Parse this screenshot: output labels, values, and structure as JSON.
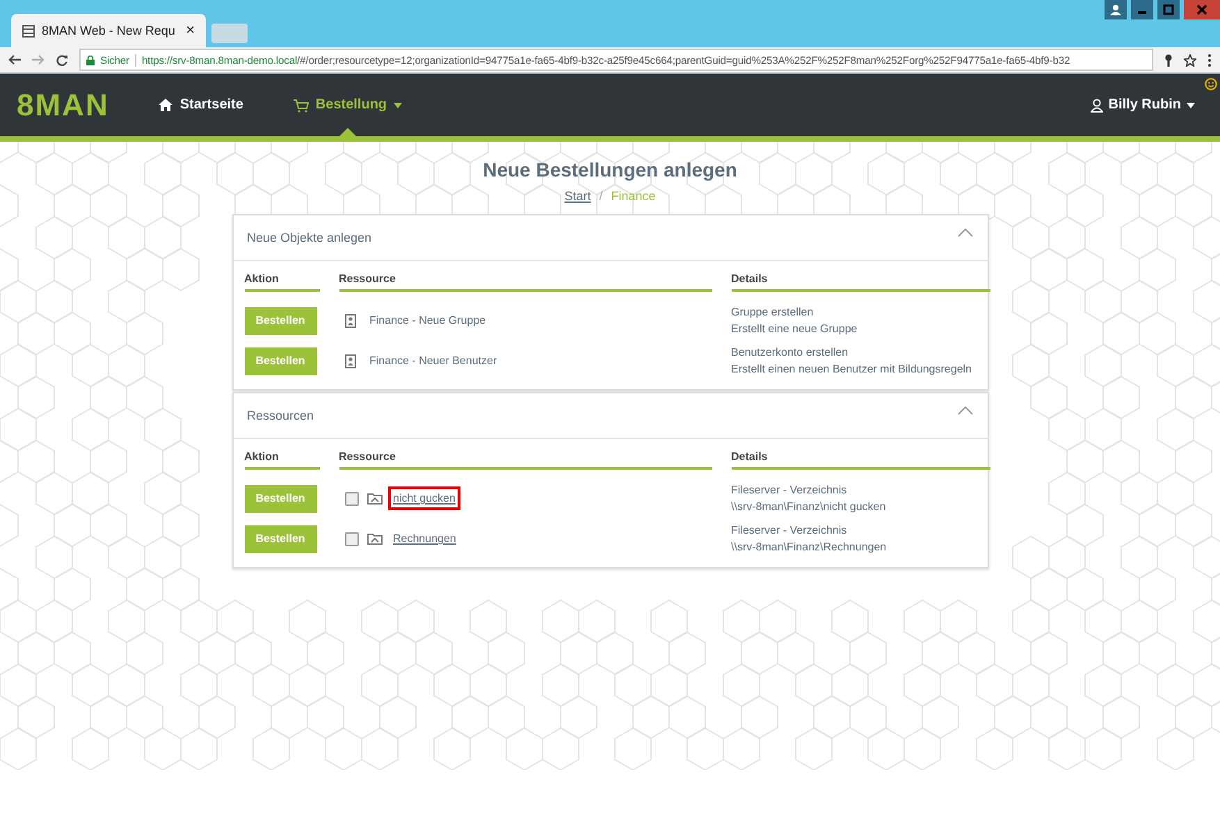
{
  "browser": {
    "tab_title": "8MAN Web - New Requ",
    "tab_close": "×",
    "secure_label": "Sicher",
    "url_host": "https://srv-8man.8man-demo.local",
    "url_path": "/#/order;resourcetype=12;organizationId=94775a1e-fa65-4bf9-b32c-a25f9e45c664;parentGuid=guid%253A%252F%252F8man%252Forg%252F94775a1e-fa65-4bf9-b32"
  },
  "navbar": {
    "logo": "8MAN",
    "items": [
      {
        "label": "Startseite",
        "kind": "home",
        "selected": false,
        "dropdown": false
      },
      {
        "label": "Bestellung",
        "kind": "cart",
        "selected": true,
        "dropdown": true
      }
    ],
    "user": "Billy Rubin"
  },
  "page": {
    "title": "Neue Bestellungen anlegen",
    "breadcrumb_separator": "/",
    "breadcrumb": [
      {
        "label": "Start",
        "kind": "link"
      },
      {
        "label": "Finance",
        "kind": "current"
      }
    ]
  },
  "panels": [
    {
      "title": "Neue Objekte anlegen",
      "expanded": true,
      "columns": [
        "Aktion",
        "Ressource",
        "Details"
      ],
      "rows": [
        {
          "button": "Bestellen",
          "kind": "object",
          "resource": "Finance - Neue Gruppe",
          "details": [
            "Gruppe erstellen",
            "Erstellt eine neue Gruppe"
          ]
        },
        {
          "button": "Bestellen",
          "kind": "object",
          "resource": "Finance - Neuer Benutzer",
          "details": [
            "Benutzerkonto erstellen",
            "Erstellt einen neuen Benutzer mit Bildungsregeln"
          ]
        }
      ]
    },
    {
      "title": "Ressourcen",
      "expanded": true,
      "columns": [
        "Aktion",
        "Ressource",
        "Details"
      ],
      "rows": [
        {
          "button": "Bestellen",
          "kind": "folder",
          "checked": false,
          "highlighted": true,
          "resource": "nicht gucken",
          "details": [
            "Fileserver - Verzeichnis",
            "\\\\srv-8man\\Finanz\\nicht gucken"
          ]
        },
        {
          "button": "Bestellen",
          "kind": "folder",
          "checked": false,
          "highlighted": false,
          "resource": "Rechnungen",
          "details": [
            "Fileserver - Verzeichnis",
            "\\\\srv-8man\\Finanz\\Rechnungen"
          ]
        }
      ]
    }
  ]
}
